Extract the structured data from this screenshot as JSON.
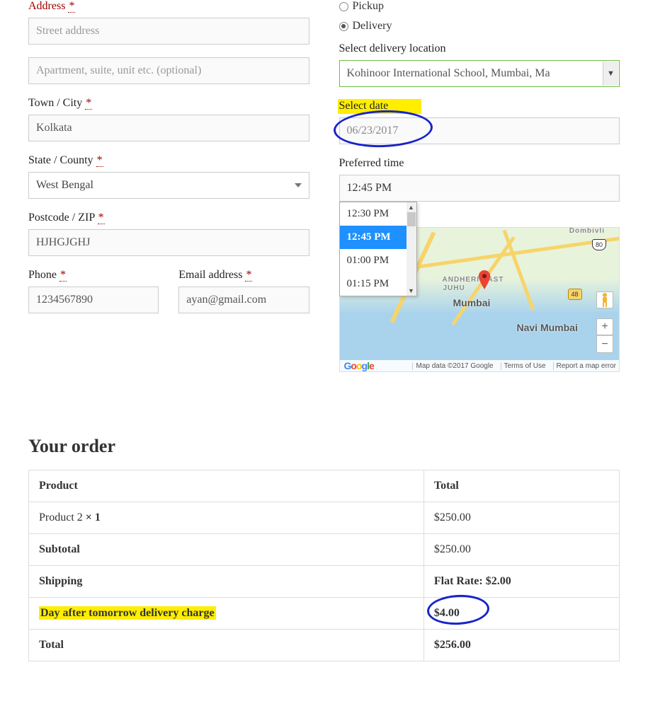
{
  "left": {
    "address_label": "Address",
    "street_ph": "Street address",
    "apt_ph": "Apartment, suite, unit etc. (optional)",
    "city_label": "Town / City",
    "city_value": "Kolkata",
    "state_label": "State / County",
    "state_value": "West Bengal",
    "zip_label": "Postcode / ZIP",
    "zip_value": "HJHGJGHJ",
    "phone_label": "Phone",
    "phone_value": "1234567890",
    "email_label": "Email address",
    "email_value": "ayan@gmail.com"
  },
  "right": {
    "pickup_label": "Pickup",
    "delivery_label": "Delivery",
    "location_label": "Select delivery location",
    "location_value": "Kohinoor International School, Mumbai, Ma",
    "date_label": "Select date",
    "date_value": "06/23/2017",
    "time_label": "Preferred time",
    "time_value": "12:45 PM",
    "time_options": [
      "12:30 PM",
      "12:45 PM",
      "01:00 PM",
      "01:15 PM"
    ]
  },
  "map": {
    "mumbai": "Mumbai",
    "navi": "Navi Mumbai",
    "andheri": "ANDHERI EAST",
    "juhu": "JUHU",
    "dombivli": "Dombivli",
    "shield_48": "48",
    "shield_80": "80",
    "google": "Google",
    "credit": "Map data ©2017 Google",
    "terms": "Terms of Use",
    "report": "Report a map error",
    "plus": "+",
    "minus": "−"
  },
  "order": {
    "title": "Your order",
    "h_product": "Product",
    "h_total": "Total",
    "item_name": "Product 2 ",
    "item_qty": " × 1",
    "item_total": "$250.00",
    "subtotal_l": "Subtotal",
    "subtotal_v": "$250.00",
    "ship_l": "Shipping",
    "ship_v": "Flat Rate: $2.00",
    "extra_l": "Day after tomorrow delivery charge",
    "extra_v": "$4.00",
    "total_l": "Total",
    "total_v": "$256.00"
  },
  "star": "*"
}
